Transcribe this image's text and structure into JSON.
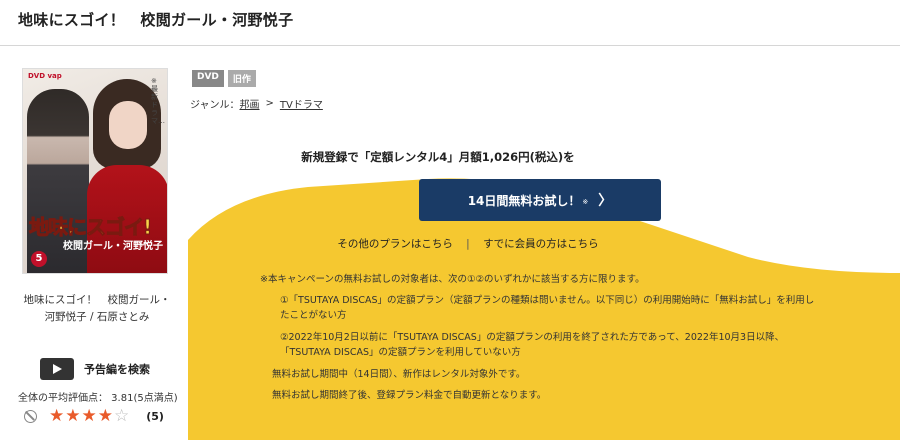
{
  "page": {
    "title": "地味にスゴイ！　校閲ガール・河野悦子"
  },
  "cover": {
    "brand": "DVD vap",
    "vertical_text": "※最新ドラマ…",
    "logo_main": "地味にスゴイ!",
    "logo_sub": "校閲ガール・河野悦子",
    "volume": "5"
  },
  "product": {
    "caption": "地味にスゴイ！　校閲ガール・河野悦子 / 石原さとみ",
    "trailer_label": "予告編を検索",
    "rating_text": "全体の平均評価点：  3.81(5点満点)",
    "rating_value": 3.81,
    "rating_max": 5,
    "stars_filled": 4,
    "rating_count": "(5)"
  },
  "badges": [
    "DVD",
    "旧作"
  ],
  "genre": {
    "label": "ジャンル：",
    "items": [
      "邦画",
      "TVドラマ"
    ],
    "separator": ">"
  },
  "offer": {
    "headline": "新規登録で「定額レンタル4」月額1,026円(税込)を",
    "cta_label": "14日間無料お試し！",
    "cta_note": "※",
    "cta_chevron": "〉",
    "link_other_plans": "その他のプランはこちら",
    "link_divider": "|",
    "link_members": "すでに会員の方はこちら",
    "panel_color": "#f5c830",
    "cta_color": "#1a3b66"
  },
  "notes": {
    "intro": "※本キャンペーンの無料お試しの対象者は、次の①②のいずれかに該当する方に限ります。",
    "item1": "①「TSUTAYA DISCAS」の定額プラン（定額プランの種類は問いません。以下同じ）の利用開始時に「無料お試し」を利用したことがない方",
    "item2": "②2022年10月2日以前に「TSUTAYA DISCAS」の定額プランの利用を終了された方であって、2022年10月3日以降、「TSUTAYA DISCAS」の定額プランを利用していない方",
    "foot1": "無料お試し期間中（14日間）、新作はレンタル対象外です。",
    "foot2": "無料お試し期間終了後、登録プラン料金で自動更新となります。"
  }
}
